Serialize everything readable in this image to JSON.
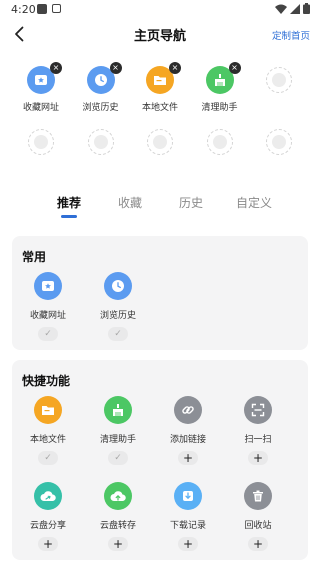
{
  "status": {
    "time": "4:20"
  },
  "header": {
    "title": "主页导航",
    "action": "定制首页"
  },
  "top_grid": {
    "items": [
      {
        "label": "收藏网址",
        "icon": "star-folder-icon",
        "color": "#5b9bf0"
      },
      {
        "label": "浏览历史",
        "icon": "clock-icon",
        "color": "#5b9bf0"
      },
      {
        "label": "本地文件",
        "icon": "folder-icon",
        "color": "#f5a623"
      },
      {
        "label": "清理助手",
        "icon": "broom-icon",
        "color": "#4cc764"
      }
    ],
    "remove_glyph": "×"
  },
  "tabs": [
    {
      "label": "推荐",
      "active": true
    },
    {
      "label": "收藏"
    },
    {
      "label": "历史"
    },
    {
      "label": "自定义"
    }
  ],
  "sections": {
    "common": {
      "title": "常用",
      "items": [
        {
          "label": "收藏网址",
          "icon": "star-folder-icon",
          "color": "#5b9bf0",
          "state": "✓"
        },
        {
          "label": "浏览历史",
          "icon": "clock-icon",
          "color": "#5b9bf0",
          "state": "✓"
        }
      ]
    },
    "quick": {
      "title": "快捷功能",
      "items": [
        {
          "label": "本地文件",
          "icon": "folder-icon",
          "color": "#f5a623",
          "state": "✓"
        },
        {
          "label": "清理助手",
          "icon": "broom-icon",
          "color": "#4cc764",
          "state": "✓"
        },
        {
          "label": "添加链接",
          "icon": "link-icon",
          "color": "#8c8f96",
          "state": "+"
        },
        {
          "label": "扫一扫",
          "icon": "scan-icon",
          "color": "#8c8f96",
          "state": "+"
        },
        {
          "label": "云盘分享",
          "icon": "cloud-share-icon",
          "color": "#35c0a8",
          "state": "+"
        },
        {
          "label": "云盘转存",
          "icon": "cloud-save-icon",
          "color": "#4cc764",
          "state": "+"
        },
        {
          "label": "下载记录",
          "icon": "download-icon",
          "color": "#5ab0f5",
          "state": "+"
        },
        {
          "label": "回收站",
          "icon": "trash-icon",
          "color": "#8c8f96",
          "state": "+"
        }
      ]
    }
  }
}
